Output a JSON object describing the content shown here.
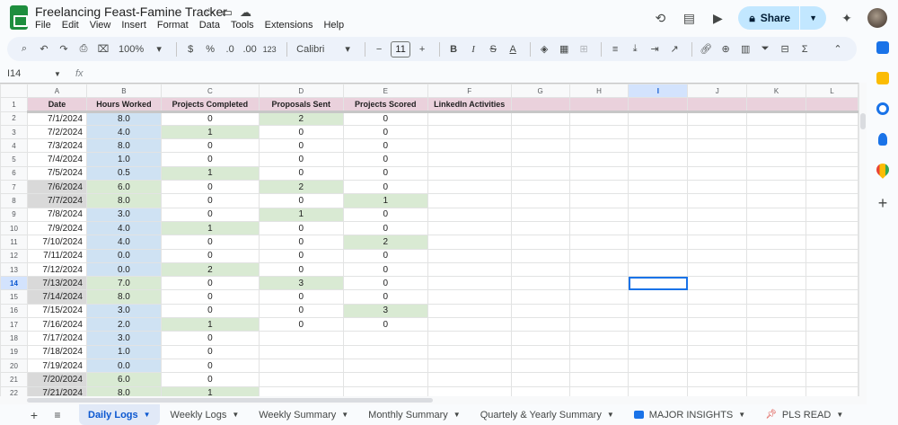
{
  "doc": {
    "title": "Freelancing Feast-Famine Tracker",
    "menu": [
      "File",
      "Edit",
      "View",
      "Insert",
      "Format",
      "Data",
      "Tools",
      "Extensions",
      "Help"
    ],
    "share_label": "Share"
  },
  "toolbar": {
    "zoom": "100%",
    "currency": "$",
    "percent": "%",
    "dec_decrease": ".0",
    "dec_increase": ".00",
    "number_format": "123",
    "font": "Calibri",
    "font_size": "11"
  },
  "formula_bar": {
    "cell_ref": "I14",
    "fx": "fx",
    "value": ""
  },
  "grid": {
    "columns": [
      "A",
      "B",
      "C",
      "D",
      "E",
      "F",
      "G",
      "H",
      "I",
      "J",
      "K",
      "L"
    ],
    "selected_column": "I",
    "selected_row": 14,
    "headers": [
      "Date",
      "Hours Worked",
      "Projects Completed",
      "Proposals Sent",
      "Projects Scored",
      "LinkedIn Activities"
    ],
    "rows": [
      {
        "num": 2,
        "date": "7/1/2024",
        "hours": "8.0",
        "completed": "0",
        "proposals": "2",
        "scored": "0"
      },
      {
        "num": 3,
        "date": "7/2/2024",
        "hours": "4.0",
        "completed": "1",
        "proposals": "0",
        "scored": "0"
      },
      {
        "num": 4,
        "date": "7/3/2024",
        "hours": "8.0",
        "completed": "0",
        "proposals": "0",
        "scored": "0"
      },
      {
        "num": 5,
        "date": "7/4/2024",
        "hours": "1.0",
        "completed": "0",
        "proposals": "0",
        "scored": "0"
      },
      {
        "num": 6,
        "date": "7/5/2024",
        "hours": "0.5",
        "completed": "1",
        "proposals": "0",
        "scored": "0"
      },
      {
        "num": 7,
        "date": "7/6/2024",
        "hours": "6.0",
        "completed": "0",
        "proposals": "2",
        "scored": "0"
      },
      {
        "num": 8,
        "date": "7/7/2024",
        "hours": "8.0",
        "completed": "0",
        "proposals": "0",
        "scored": "1"
      },
      {
        "num": 9,
        "date": "7/8/2024",
        "hours": "3.0",
        "completed": "0",
        "proposals": "1",
        "scored": "0"
      },
      {
        "num": 10,
        "date": "7/9/2024",
        "hours": "4.0",
        "completed": "1",
        "proposals": "0",
        "scored": "0"
      },
      {
        "num": 11,
        "date": "7/10/2024",
        "hours": "4.0",
        "completed": "0",
        "proposals": "0",
        "scored": "2"
      },
      {
        "num": 12,
        "date": "7/11/2024",
        "hours": "0.0",
        "completed": "0",
        "proposals": "0",
        "scored": "0"
      },
      {
        "num": 13,
        "date": "7/12/2024",
        "hours": "0.0",
        "completed": "2",
        "proposals": "0",
        "scored": "0"
      },
      {
        "num": 14,
        "date": "7/13/2024",
        "hours": "7.0",
        "completed": "0",
        "proposals": "3",
        "scored": "0"
      },
      {
        "num": 15,
        "date": "7/14/2024",
        "hours": "8.0",
        "completed": "0",
        "proposals": "0",
        "scored": "0"
      },
      {
        "num": 16,
        "date": "7/15/2024",
        "hours": "3.0",
        "completed": "0",
        "proposals": "0",
        "scored": "3"
      },
      {
        "num": 17,
        "date": "7/16/2024",
        "hours": "2.0",
        "completed": "1",
        "proposals": "0",
        "scored": "0"
      },
      {
        "num": 18,
        "date": "7/17/2024",
        "hours": "3.0",
        "completed": "0",
        "proposals": "",
        "scored": ""
      },
      {
        "num": 19,
        "date": "7/18/2024",
        "hours": "1.0",
        "completed": "0",
        "proposals": "",
        "scored": ""
      },
      {
        "num": 20,
        "date": "7/19/2024",
        "hours": "0.0",
        "completed": "0",
        "proposals": "",
        "scored": ""
      },
      {
        "num": 21,
        "date": "7/20/2024",
        "hours": "6.0",
        "completed": "0",
        "proposals": "",
        "scored": ""
      },
      {
        "num": 22,
        "date": "7/21/2024",
        "hours": "8.0",
        "completed": "1",
        "proposals": "",
        "scored": ""
      }
    ],
    "weekend_dates": [
      "7/6/2024",
      "7/7/2024",
      "7/13/2024",
      "7/14/2024",
      "7/20/2024",
      "7/21/2024"
    ],
    "colors": {
      "header_fill": "#ead1dc",
      "hours_fill": "#cfe2f3",
      "count_fill": "#d9ead3",
      "weekend_fill": "#d9d9d9",
      "selection": "#1a73e8"
    }
  },
  "sheets": {
    "tabs": [
      {
        "label": "Daily Logs",
        "active": true
      },
      {
        "label": "Weekly Logs",
        "active": false
      },
      {
        "label": "Weekly Summary",
        "active": false
      },
      {
        "label": "Monthly Summary",
        "active": false
      },
      {
        "label": "Quartely & Yearly Summary",
        "active": false
      },
      {
        "label": "MAJOR INSIGHTS",
        "active": false,
        "icon": "arrow-right-box-icon"
      },
      {
        "label": "PLS READ",
        "active": false,
        "icon": "pushpin-icon"
      }
    ]
  }
}
